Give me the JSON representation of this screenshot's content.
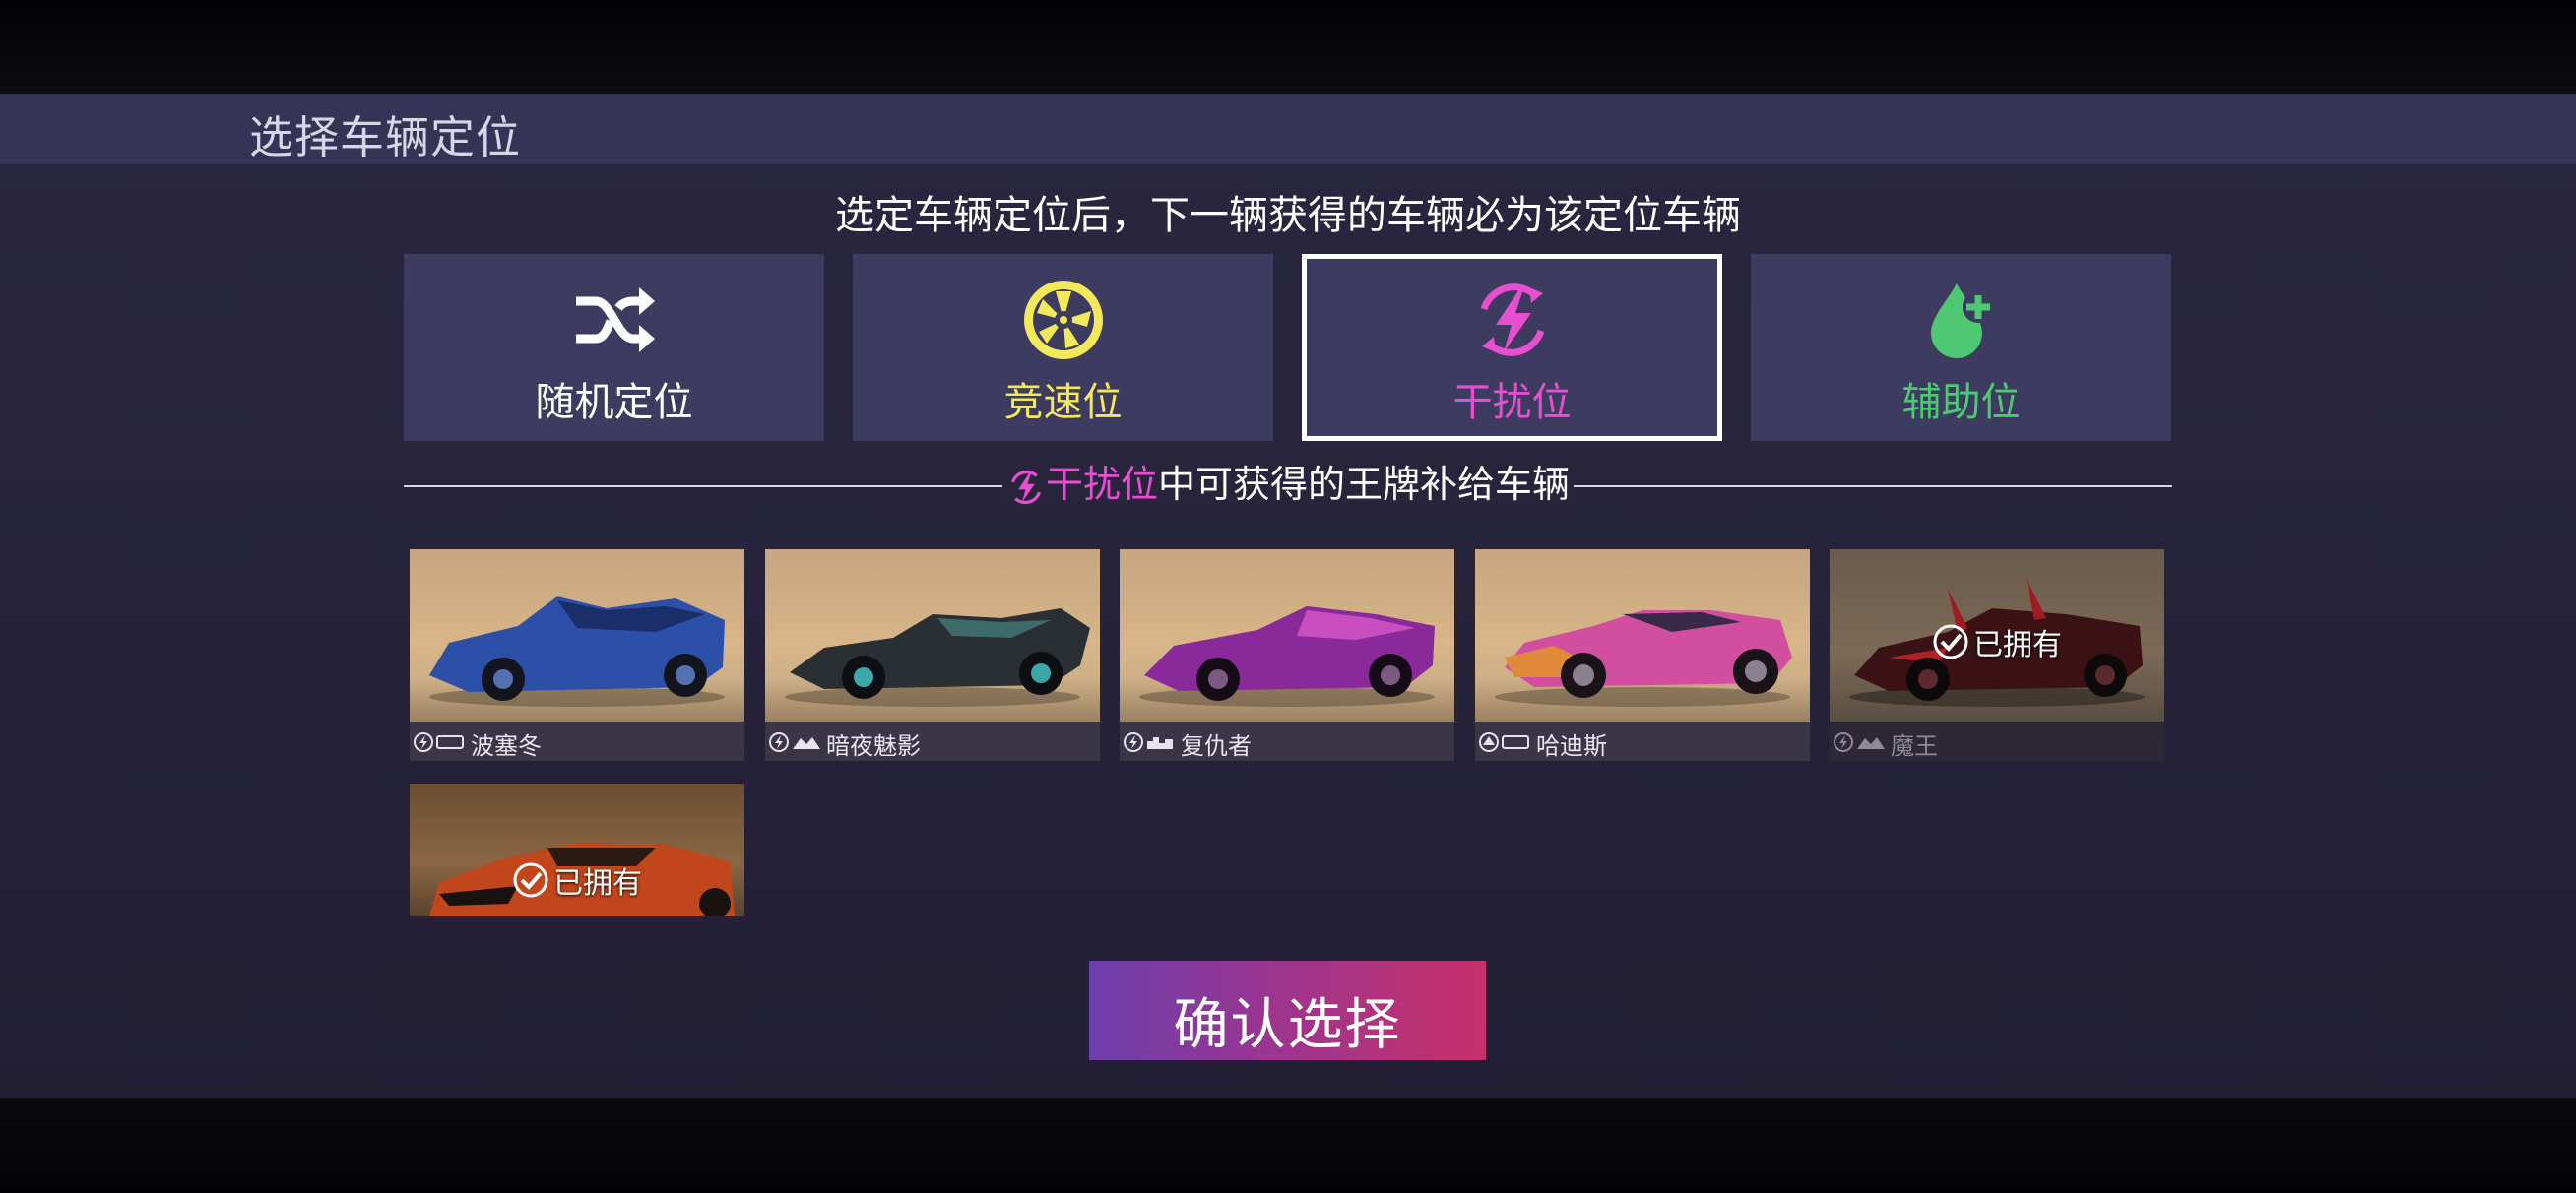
{
  "header": {
    "title": "选择车辆定位"
  },
  "subtitle": "选定车辆定位后，下一辆获得的车辆必为该定位车辆",
  "roles": [
    {
      "label": "随机定位",
      "icon": "shuffle-icon",
      "color": "#ffffff",
      "selected": false
    },
    {
      "label": "竞速位",
      "icon": "wheel-icon",
      "color": "#f3e85a",
      "selected": false
    },
    {
      "label": "干扰位",
      "icon": "lightning-icon",
      "color": "#e84fd0",
      "selected": true
    },
    {
      "label": "辅助位",
      "icon": "drop-plus-icon",
      "color": "#4fc873",
      "selected": false
    }
  ],
  "section": {
    "role": "干扰位",
    "rest": "中可获得的王牌补给车辆"
  },
  "cars": [
    {
      "name": "波塞冬",
      "owned": false,
      "body_color": "#2c4fa8"
    },
    {
      "name": "暗夜魅影",
      "owned": false,
      "body_color": "#2a2f33"
    },
    {
      "name": "复仇者",
      "owned": false,
      "body_color": "#8a2a9a"
    },
    {
      "name": "哈迪斯",
      "owned": false,
      "body_color": "#d24fa0"
    },
    {
      "name": "魔王",
      "owned": true,
      "owned_label": "已拥有",
      "body_color": "#3a1216"
    },
    {
      "owned": true,
      "owned_label": "已拥有",
      "body_color": "#c2461c"
    }
  ],
  "confirm_label": "确认选择",
  "colors": {
    "accent": "#e84fd0",
    "panel": "#3d3c60",
    "selected_border": "#ffffff"
  }
}
